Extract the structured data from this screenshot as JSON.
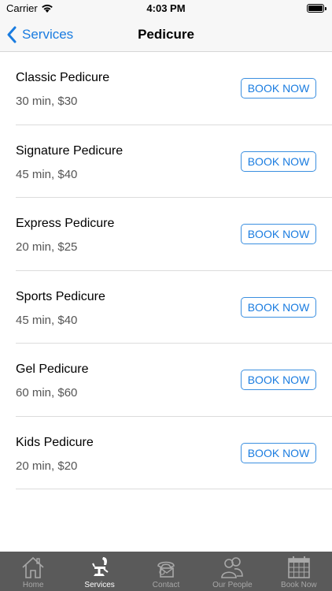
{
  "status": {
    "carrier": "Carrier",
    "time": "4:03 PM"
  },
  "nav": {
    "back_label": "Services",
    "title": "Pedicure"
  },
  "services": [
    {
      "name": "Classic Pedicure",
      "meta": "30 min, $30",
      "button": "BOOK NOW"
    },
    {
      "name": "Signature Pedicure",
      "meta": "45 min, $40",
      "button": "BOOK NOW"
    },
    {
      "name": "Express Pedicure",
      "meta": "20 min, $25",
      "button": "BOOK NOW"
    },
    {
      "name": "Sports Pedicure",
      "meta": "45 min, $40",
      "button": "BOOK NOW"
    },
    {
      "name": "Gel Pedicure",
      "meta": "60 min, $60",
      "button": "BOOK NOW"
    },
    {
      "name": "Kids Pedicure",
      "meta": "20 min, $20",
      "button": "BOOK NOW"
    }
  ],
  "tabs": [
    {
      "label": "Home",
      "icon": "home-icon",
      "active": false
    },
    {
      "label": "Services",
      "icon": "salon-chair-icon",
      "active": true
    },
    {
      "label": "Contact",
      "icon": "phone-mail-icon",
      "active": false
    },
    {
      "label": "Our People",
      "icon": "people-icon",
      "active": false
    },
    {
      "label": "Book Now",
      "icon": "calendar-icon",
      "active": false
    }
  ],
  "colors": {
    "accent": "#1a7ce0",
    "tab_bar": "#5a5a5a",
    "tab_inactive": "#a8a8a8",
    "tab_active": "#ffffff"
  }
}
